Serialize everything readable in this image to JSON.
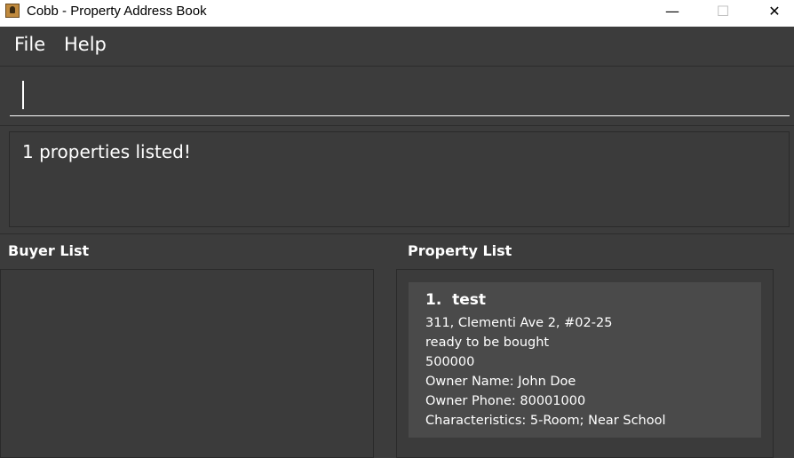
{
  "window": {
    "title": "Cobb - Property Address Book",
    "controls": {
      "minimize": "—",
      "maximize": "☐",
      "close": "✕"
    }
  },
  "menu": {
    "file": "File",
    "help": "Help"
  },
  "command": {
    "value": "",
    "placeholder": ""
  },
  "result": {
    "message": "1 properties listed!"
  },
  "buyer_list": {
    "title": "Buyer List",
    "items": []
  },
  "property_list": {
    "title": "Property List",
    "items": [
      {
        "index": "1.",
        "name": "test",
        "address": "311, Clementi Ave 2, #02-25",
        "status": "ready to be bought",
        "price": "500000",
        "owner_name": "Owner Name: John Doe",
        "owner_phone": "Owner Phone: 80001000",
        "characteristics": "Characteristics: 5-Room; Near School"
      }
    ]
  }
}
